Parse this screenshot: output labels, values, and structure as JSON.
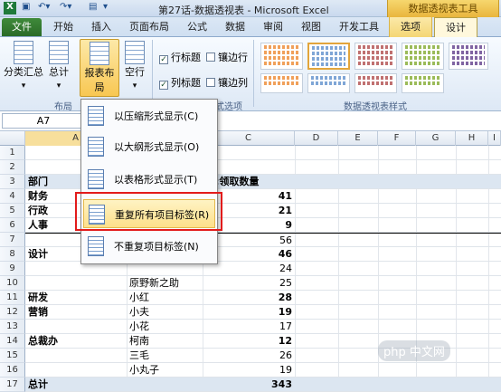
{
  "window": {
    "title": "第27话-数据透视表 - Microsoft Excel",
    "context_tools": "数据透视表工具"
  },
  "tabs": [
    "文件",
    "开始",
    "插入",
    "页面布局",
    "公式",
    "数据",
    "审阅",
    "视图",
    "开发工具",
    "选项",
    "设计"
  ],
  "ribbon": {
    "subtotal_label": "分类汇总",
    "grandtotal_label": "总计",
    "report_layout_label": "报表布局",
    "blank_rows_label": "空行",
    "layout_group_label": "布局",
    "checkboxes": [
      {
        "label": "行标题",
        "checked": true
      },
      {
        "label": "镶边行",
        "checked": false
      },
      {
        "label": "列标题",
        "checked": true
      },
      {
        "label": "镶边列",
        "checked": false
      }
    ],
    "style_options_group_label": "数据透视表样式选项",
    "styles_group_label": "数据透视表样式"
  },
  "namebox": "A7",
  "columns": [
    "A",
    "B",
    "C",
    "D",
    "E",
    "F",
    "G",
    "H",
    "I"
  ],
  "rows": [
    {
      "n": "1",
      "a": "",
      "b": "",
      "c": ""
    },
    {
      "n": "2",
      "a": "",
      "b": "",
      "c": ""
    },
    {
      "n": "3",
      "a": "部门",
      "b": "",
      "c": "项:领取数量"
    },
    {
      "n": "4",
      "a": "财务",
      "b": "",
      "c": "41"
    },
    {
      "n": "5",
      "a": "行政",
      "b": "",
      "c": "21"
    },
    {
      "n": "6",
      "a": "人事",
      "b": "",
      "c": "9"
    },
    {
      "n": "7",
      "a": "",
      "b": "",
      "c": "56"
    },
    {
      "n": "8",
      "a": "设计",
      "b": "",
      "c": "46"
    },
    {
      "n": "9",
      "a": "",
      "b": "",
      "c": "24"
    },
    {
      "n": "10",
      "a": "",
      "b": "原野新之助",
      "c": "25"
    },
    {
      "n": "11",
      "a": "研发",
      "b": "小红",
      "c": "28"
    },
    {
      "n": "12",
      "a": "营销",
      "b": "小夫",
      "c": "19"
    },
    {
      "n": "13",
      "a": "",
      "b": "小花",
      "c": "17"
    },
    {
      "n": "14",
      "a": "总裁办",
      "b": "柯南",
      "c": "12"
    },
    {
      "n": "15",
      "a": "",
      "b": "三毛",
      "c": "26"
    },
    {
      "n": "16",
      "a": "",
      "b": "小丸子",
      "c": "19"
    },
    {
      "n": "17",
      "a": "总计",
      "b": "",
      "c": "343"
    }
  ],
  "dropdown": [
    {
      "label": "以压缩形式显示(C)"
    },
    {
      "label": "以大纲形式显示(O)"
    },
    {
      "label": "以表格形式显示(T)"
    },
    {
      "label": "重复所有项目标签(R)"
    },
    {
      "label": "不重复项目标签(N)"
    }
  ],
  "watermark": "php 中文网"
}
